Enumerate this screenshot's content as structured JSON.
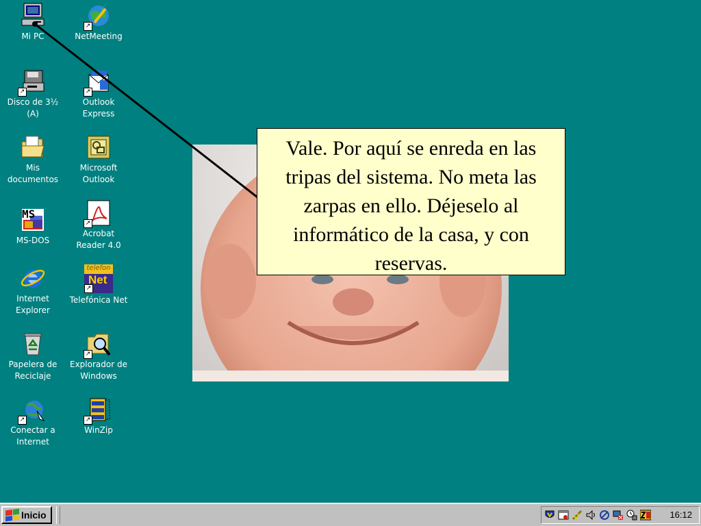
{
  "desktop": {
    "icons": [
      {
        "label": "Mi PC",
        "icon": "computer-icon"
      },
      {
        "label": "NetMeeting",
        "icon": "netmeeting-icon"
      },
      {
        "label": "Disco de 3½\n(A)",
        "icon": "floppy-drive-icon"
      },
      {
        "label": "Outlook\nExpress",
        "icon": "outlook-express-icon"
      },
      {
        "label": "Mis\ndocumentos",
        "icon": "my-documents-folder-icon"
      },
      {
        "label": "Microsoft\nOutlook",
        "icon": "microsoft-outlook-icon"
      },
      {
        "label": "MS-DOS",
        "icon": "ms-dos-icon"
      },
      {
        "label": "Acrobat\nReader 4.0",
        "icon": "acrobat-reader-icon"
      },
      {
        "label": "Internet\nExplorer",
        "icon": "internet-explorer-icon"
      },
      {
        "label": "Telefónica Net",
        "icon": "telefonica-net-icon"
      },
      {
        "label": "Papelera de\nReciclaje",
        "icon": "recycle-bin-icon"
      },
      {
        "label": "Explorador de\nWindows",
        "icon": "windows-explorer-icon"
      },
      {
        "label": "Conectar a\nInternet",
        "icon": "connect-internet-icon"
      },
      {
        "label": "WinZip",
        "icon": "winzip-icon"
      }
    ],
    "shortcut_glyph": "↗",
    "ms_dos_glyph": "MS",
    "telefonica_glyph_top": "telefon",
    "telefonica_glyph": "Net"
  },
  "callout": {
    "text": "Vale. Por aquí se enreda en las tripas del sistema. No meta las zarpas en ello. Déjeselo al informático de la casa, y con reservas."
  },
  "taskbar": {
    "start_label": "Inicio",
    "clock": "16:12",
    "tray_icons": [
      "antivirus-shield-icon",
      "calendar-icon",
      "network-icon",
      "volume-icon",
      "modem-icon",
      "display-icon",
      "task-scheduler-icon",
      "zonealarm-icon"
    ]
  },
  "colors": {
    "desktop_bg": "#008080",
    "callout_bg": "#ffffcc",
    "taskbar_bg": "#c0c0c0"
  }
}
